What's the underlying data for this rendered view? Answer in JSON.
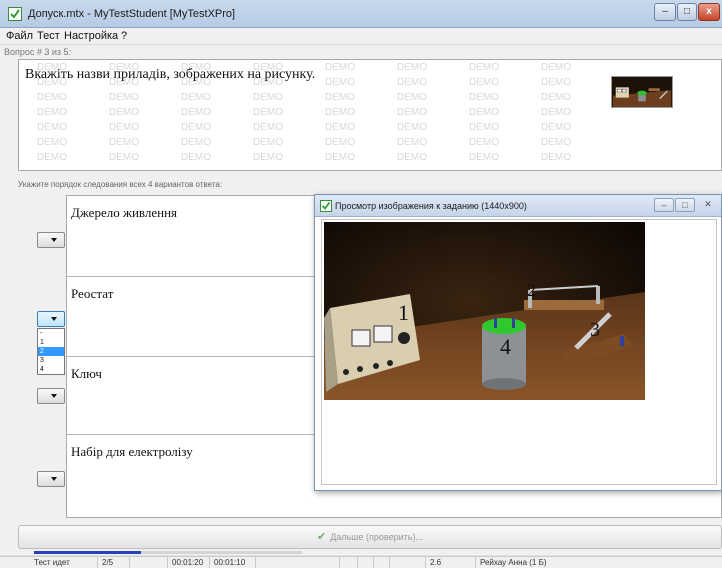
{
  "window": {
    "title": "Допуск.mtx - MyTestStudent [MyTestXPro]",
    "buttons": {
      "minimize": "–",
      "maximize": "□",
      "close": "x"
    }
  },
  "menu": [
    "Файл",
    "Тест",
    "Настройка",
    "?"
  ],
  "question": {
    "counter": "Вопрос # 3 из 5:",
    "text": "Вкажіть назви приладів, зображених на рисунку.",
    "watermark": "DEMO"
  },
  "instruction": "Укажите порядок следования всех 4 вариантов ответа:",
  "answers": [
    {
      "text": "Джерело живлення"
    },
    {
      "text": "Реостат"
    },
    {
      "text": "Ключ"
    },
    {
      "text": "Набір для електролізу"
    }
  ],
  "dropdown": {
    "options": [
      "-",
      "1",
      "2",
      "3",
      "4"
    ],
    "highlighted": "2"
  },
  "next_button": "Дальше (проверить)...",
  "progress": {
    "fraction": 0.4
  },
  "status": {
    "state": "Тест идет",
    "question": "2/5",
    "time_elapsed": "00:01:20",
    "time_question": "00:01:10",
    "score": "2.6",
    "student": "Рейхау Анна (1 Б)"
  },
  "preview_window": {
    "title": "Просмотр изображения к заданию (1440x900)",
    "image_labels": [
      "1",
      "2",
      "3",
      "4"
    ]
  },
  "colors": {
    "accent": "#2b3fbf",
    "check_green": "#3aa13a",
    "scene_wood": "#6b3f1e",
    "scene_green": "#29c229"
  }
}
